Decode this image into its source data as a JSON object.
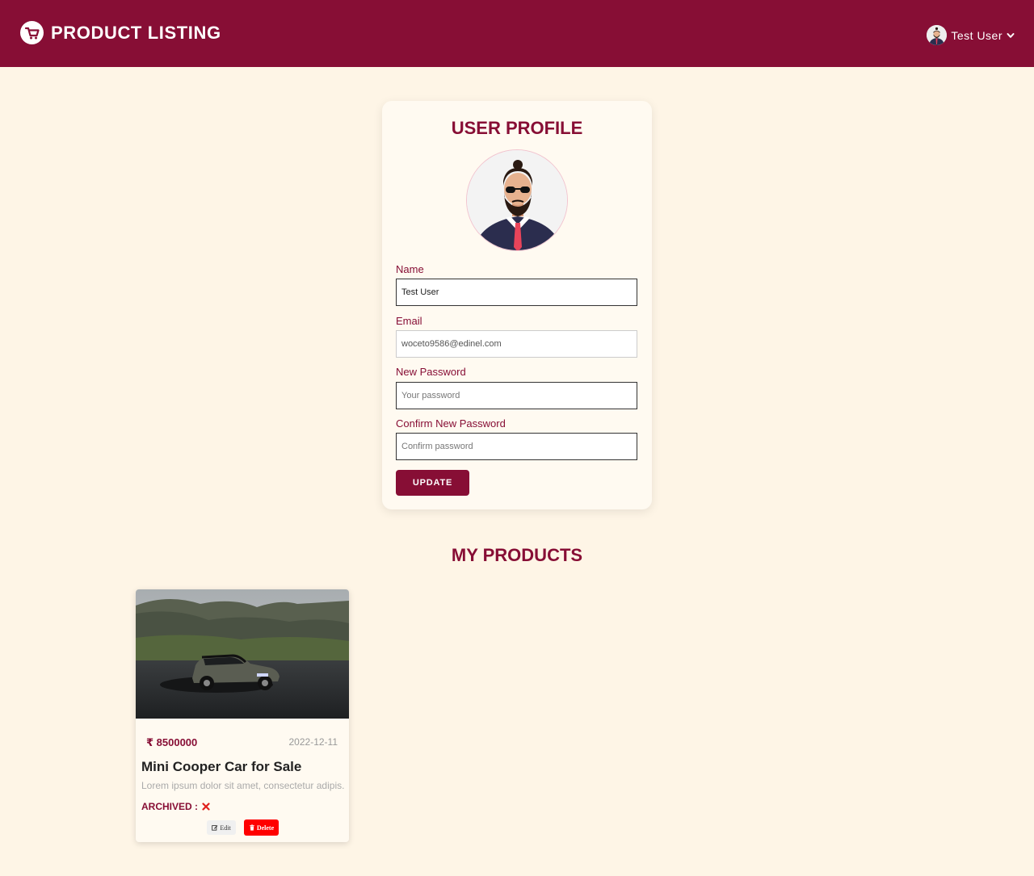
{
  "navbar": {
    "brand": "PRODUCT LISTING",
    "user_name": "Test User"
  },
  "profile": {
    "title": "USER PROFILE",
    "name_label": "Name",
    "name_value": "Test User",
    "email_label": "Email",
    "email_value": "woceto9586@edinel.com",
    "new_password_label": "New Password",
    "new_password_placeholder": "Your password",
    "confirm_password_label": "Confirm New Password",
    "confirm_password_placeholder": "Confirm password",
    "update_label": "UPDATE"
  },
  "products_section": {
    "title": "MY PRODUCTS",
    "items": [
      {
        "price": "₹ 8500000",
        "date": "2022-12-11",
        "name": "Mini Cooper Car for Sale",
        "description": "Lorem ipsum dolor sit amet, consectetur adipis...",
        "archived_label": "ARCHIVED :",
        "archived_icon": "x-icon",
        "edit_label": "Edit",
        "delete_label": "Delete"
      }
    ]
  },
  "colors": {
    "primary": "#870e35",
    "background": "#fef5e6",
    "card": "#fffaf1",
    "danger": "#ff0000"
  }
}
